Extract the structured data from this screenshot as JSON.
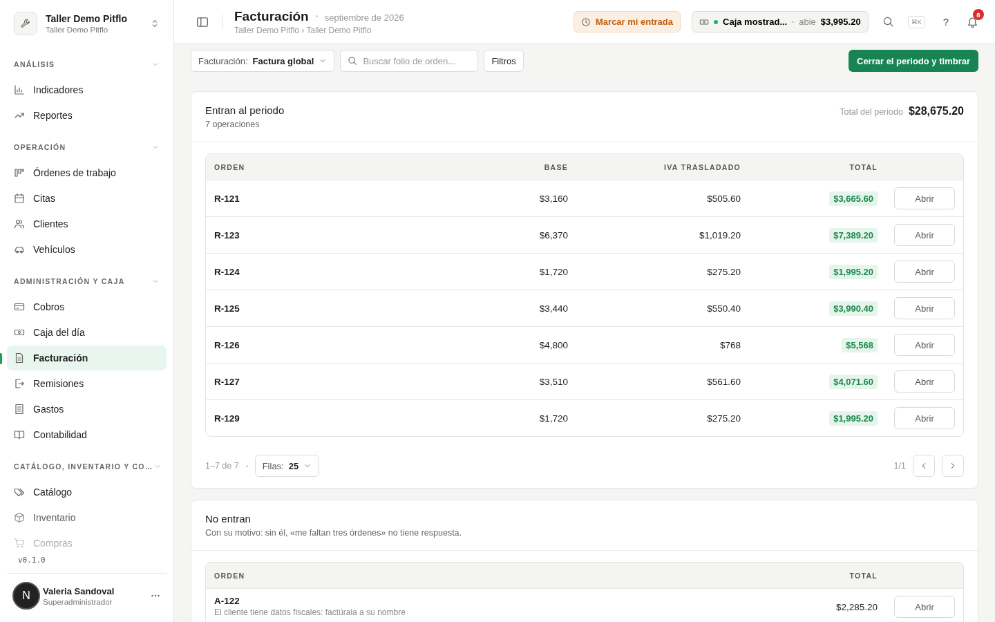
{
  "workspace": {
    "name": "Taller Demo Pitflo",
    "subtitle": "Taller Demo Pitflo"
  },
  "sidebar": {
    "sections": [
      {
        "title": "ANÁLISIS",
        "expanded": true,
        "items": [
          {
            "label": "Indicadores",
            "selected": false
          },
          {
            "label": "Reportes",
            "selected": false
          }
        ]
      },
      {
        "title": "OPERACIÓN",
        "expanded": true,
        "items": [
          {
            "label": "Órdenes de trabajo",
            "selected": false
          },
          {
            "label": "Citas",
            "selected": false
          },
          {
            "label": "Clientes",
            "selected": false
          },
          {
            "label": "Vehículos",
            "selected": false
          }
        ]
      },
      {
        "title": "ADMINISTRACIÓN Y CAJA",
        "expanded": true,
        "items": [
          {
            "label": "Cobros",
            "selected": false
          },
          {
            "label": "Caja del día",
            "selected": false
          },
          {
            "label": "Facturación",
            "selected": true
          },
          {
            "label": "Remisiones",
            "selected": false
          },
          {
            "label": "Gastos",
            "selected": false
          },
          {
            "label": "Contabilidad",
            "selected": false
          }
        ]
      },
      {
        "title": "CATÁLOGO, INVENTARIO Y CO…",
        "expanded": true,
        "items": [
          {
            "label": "Catálogo",
            "selected": false
          },
          {
            "label": "Inventario",
            "selected": false
          },
          {
            "label": "Compras",
            "selected": false
          }
        ]
      }
    ],
    "version": "v0.1.0",
    "user": {
      "initial": "N",
      "name": "Valeria Sandoval",
      "role": "Superadministrador"
    }
  },
  "header": {
    "title": "Facturación",
    "period": "septiembre de 2026",
    "breadcrumb": "Taller Demo Pitflo › Taller Demo Pitflo",
    "clock_in": "Marcar mi entrada",
    "register": {
      "name": "Caja mostrad...",
      "status": "abie",
      "amount": "$3,995.20"
    },
    "shortcut": "⌘K",
    "help": "?",
    "notifications": "8"
  },
  "toolbar": {
    "billing": {
      "label": "Facturación:",
      "value": "Factura global"
    },
    "search": {
      "placeholder": "Buscar folio de orden..."
    },
    "filters": "Filtros",
    "primary": "Cerrar el periodo y timbrar"
  },
  "sections": [
    {
      "kind": "included",
      "title": "Entran al periodo",
      "subtitle": "7 operaciones",
      "total_label": "Total del periodo",
      "total": "$28,675.20",
      "columns": [
        "ORDEN",
        "BASE",
        "IVA TRASLADADO",
        "TOTAL"
      ],
      "rows": [
        {
          "order": "R-121",
          "base": "$3,160",
          "iva": "$505.60",
          "total": "$3,665.60",
          "action": "Abrir"
        },
        {
          "order": "R-123",
          "base": "$6,370",
          "iva": "$1,019.20",
          "total": "$7,389.20",
          "action": "Abrir"
        },
        {
          "order": "R-124",
          "base": "$1,720",
          "iva": "$275.20",
          "total": "$1,995.20",
          "action": "Abrir"
        },
        {
          "order": "R-125",
          "base": "$3,440",
          "iva": "$550.40",
          "total": "$3,990.40",
          "action": "Abrir"
        },
        {
          "order": "R-126",
          "base": "$4,800",
          "iva": "$768",
          "total": "$5,568",
          "action": "Abrir"
        },
        {
          "order": "R-127",
          "base": "$3,510",
          "iva": "$561.60",
          "total": "$4,071.60",
          "action": "Abrir"
        },
        {
          "order": "R-129",
          "base": "$1,720",
          "iva": "$275.20",
          "total": "$1,995.20",
          "action": "Abrir"
        }
      ],
      "footer": {
        "range": "1–7 de 7",
        "rows_label": "Filas:",
        "rows_value": "25",
        "page": "1/1"
      }
    },
    {
      "kind": "excluded",
      "title": "No entran",
      "subtitle": "Con su motivo: sin él, «me faltan tres órdenes» no tiene respuesta.",
      "columns": [
        "ORDEN",
        "TOTAL"
      ],
      "rows": [
        {
          "order": "A-122",
          "note": "El cliente tiene datos fiscales: factúrala a su nombre",
          "total": "$2,285.20",
          "action": "Abrir"
        }
      ]
    }
  ]
}
